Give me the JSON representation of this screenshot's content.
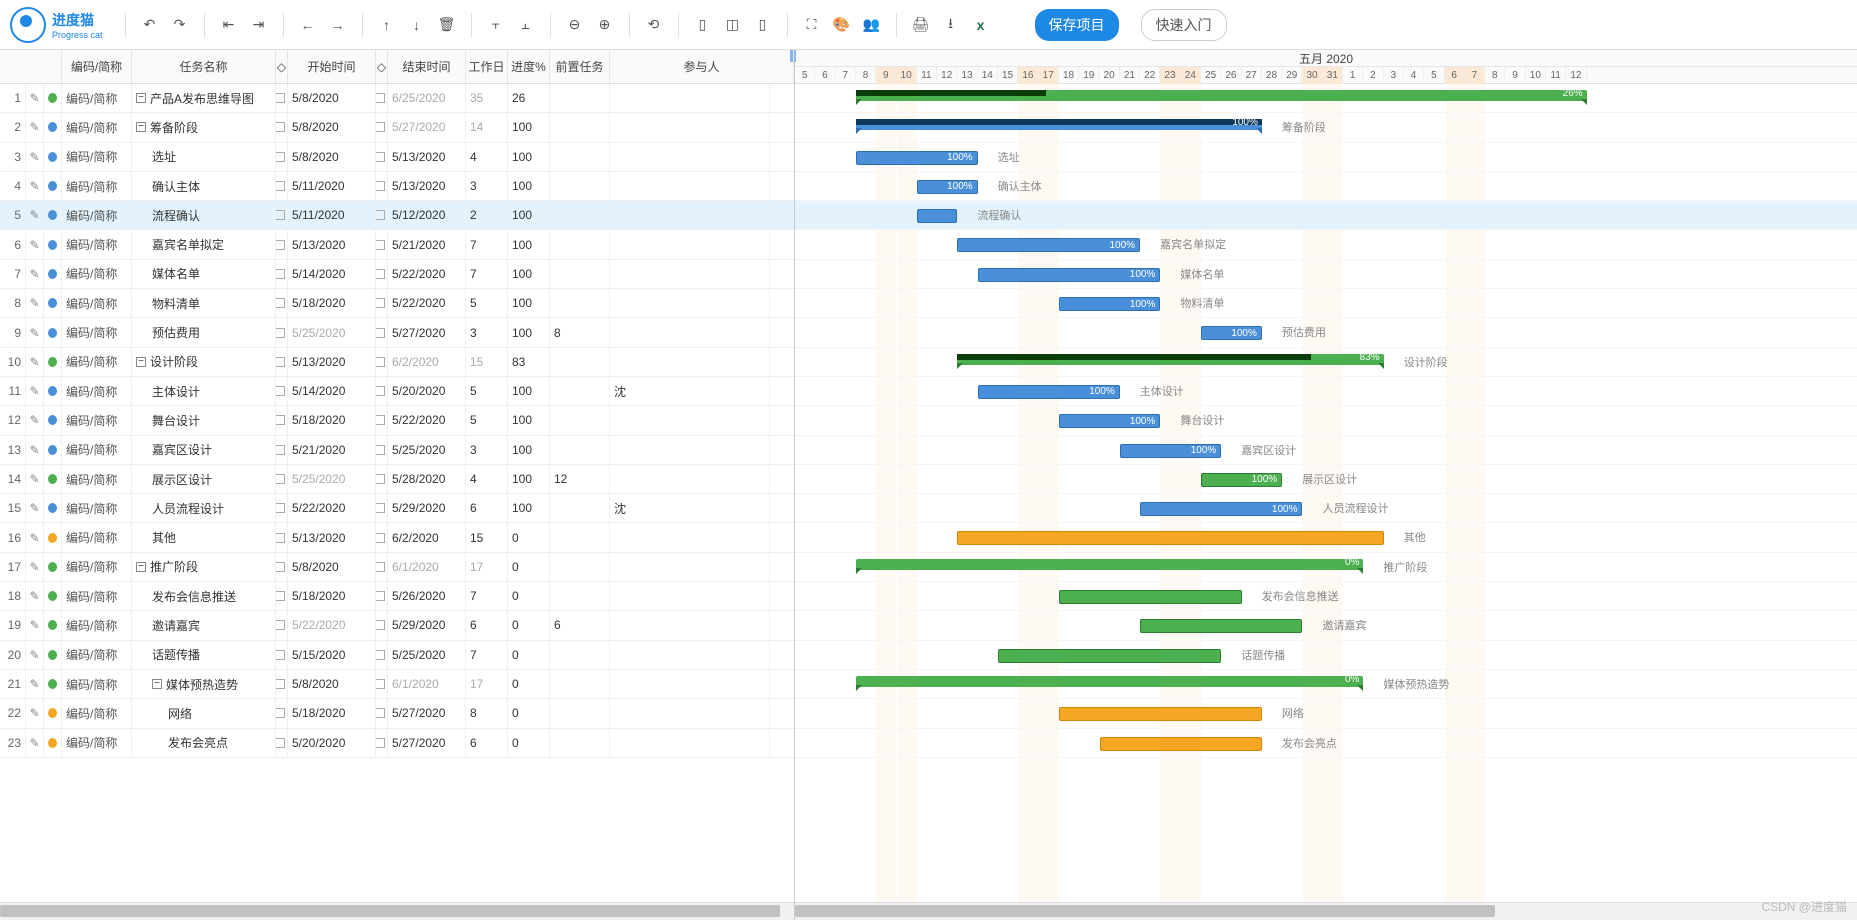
{
  "app": {
    "name_cn": "进度猫",
    "name_en": "Progress cat",
    "save": "保存项目",
    "quick": "快速入门"
  },
  "toolbar_icons": [
    "undo",
    "redo",
    "outdent",
    "indent",
    "move-left",
    "move-right",
    "move-up",
    "move-down",
    "delete",
    "top-align",
    "bottom-align",
    "zoom-out",
    "zoom-in",
    "fit",
    "col1",
    "col2",
    "col3",
    "fullscreen",
    "theme",
    "users",
    "print",
    "export",
    "excel"
  ],
  "columns": {
    "code": "编码/简称",
    "name": "任务名称",
    "start": "开始时间",
    "end": "结束时间",
    "days": "工作日",
    "progress": "进度%",
    "pred": "前置任务",
    "part": "参与人"
  },
  "timeline": {
    "month": "五月 2020",
    "days": [
      5,
      6,
      7,
      8,
      9,
      10,
      11,
      12,
      13,
      14,
      15,
      16,
      17,
      18,
      19,
      20,
      21,
      22,
      23,
      24,
      25,
      26,
      27,
      28,
      29,
      30,
      31,
      1,
      2,
      3,
      4,
      5,
      6,
      7,
      8,
      9,
      10,
      11,
      12
    ],
    "weekend_idx": [
      4,
      5,
      11,
      12,
      18,
      19,
      25,
      26,
      32,
      33
    ]
  },
  "code_label": "编码/简称",
  "tasks": [
    {
      "n": 1,
      "dot": "#4caf50",
      "name": "产品A发布思维导图",
      "exp": "-",
      "ind": 0,
      "start": "5/8/2020",
      "sf": false,
      "end": "6/25/2020",
      "ef": true,
      "days": "35",
      "df": true,
      "prog": "26",
      "type": "sum",
      "color": "g",
      "s": 3,
      "e": 38,
      "pct": 26
    },
    {
      "n": 2,
      "dot": "#4a90d9",
      "name": "筹备阶段",
      "exp": "-",
      "ind": 0,
      "start": "5/8/2020",
      "sf": false,
      "end": "5/27/2020",
      "ef": true,
      "days": "14",
      "df": true,
      "prog": "100",
      "type": "sum",
      "color": "b",
      "s": 3,
      "e": 22,
      "pct": 100,
      "lbl": "筹备阶段"
    },
    {
      "n": 3,
      "dot": "#4a90d9",
      "name": "选址",
      "ind": 1,
      "start": "5/8/2020",
      "sf": false,
      "end": "5/13/2020",
      "ef": false,
      "days": "4",
      "prog": "100",
      "type": "bar",
      "color": "blue",
      "s": 3,
      "e": 8,
      "lbl": "选址"
    },
    {
      "n": 4,
      "dot": "#4a90d9",
      "name": "确认主体",
      "ind": 1,
      "start": "5/11/2020",
      "sf": false,
      "end": "5/13/2020",
      "ef": false,
      "days": "3",
      "prog": "100",
      "type": "bar",
      "color": "blue",
      "s": 6,
      "e": 8,
      "lbl": "确认主体"
    },
    {
      "n": 5,
      "dot": "#4a90d9",
      "name": "流程确认",
      "ind": 1,
      "start": "5/11/2020",
      "sf": false,
      "end": "5/12/2020",
      "ef": false,
      "days": "2",
      "prog": "100",
      "type": "bar",
      "color": "blue",
      "s": 6,
      "e": 7,
      "lbl": "流程确认",
      "sel": true,
      "nopct": true
    },
    {
      "n": 6,
      "dot": "#4a90d9",
      "name": "嘉宾名单拟定",
      "ind": 1,
      "start": "5/13/2020",
      "sf": false,
      "end": "5/21/2020",
      "ef": false,
      "days": "7",
      "prog": "100",
      "type": "bar",
      "color": "blue",
      "s": 8,
      "e": 16,
      "lbl": "嘉宾名单拟定",
      "link_to": 9
    },
    {
      "n": 7,
      "dot": "#4a90d9",
      "name": "媒体名单",
      "ind": 1,
      "start": "5/14/2020",
      "sf": false,
      "end": "5/22/2020",
      "ef": false,
      "days": "7",
      "prog": "100",
      "type": "bar",
      "color": "blue",
      "s": 9,
      "e": 17,
      "lbl": "媒体名单"
    },
    {
      "n": 8,
      "dot": "#4a90d9",
      "name": "物料清单",
      "ind": 1,
      "start": "5/18/2020",
      "sf": false,
      "end": "5/22/2020",
      "ef": false,
      "days": "5",
      "prog": "100",
      "type": "bar",
      "color": "blue",
      "s": 13,
      "e": 17,
      "lbl": "物料清单"
    },
    {
      "n": 9,
      "dot": "#4a90d9",
      "name": "预估费用",
      "ind": 1,
      "start": "5/25/2020",
      "sf": true,
      "end": "5/27/2020",
      "ef": false,
      "days": "3",
      "prog": "100",
      "pred": "8",
      "type": "bar",
      "color": "blue",
      "s": 20,
      "e": 22,
      "lbl": "预估费用"
    },
    {
      "n": 10,
      "dot": "#4caf50",
      "name": "设计阶段",
      "exp": "-",
      "ind": 0,
      "start": "5/13/2020",
      "sf": false,
      "end": "6/2/2020",
      "ef": true,
      "days": "15",
      "df": true,
      "prog": "83",
      "type": "sum",
      "color": "g",
      "s": 8,
      "e": 28,
      "pct": 83,
      "lbl": "设计阶段"
    },
    {
      "n": 11,
      "dot": "#4a90d9",
      "name": "主体设计",
      "ind": 1,
      "start": "5/14/2020",
      "sf": false,
      "end": "5/20/2020",
      "ef": false,
      "days": "5",
      "prog": "100",
      "part": "沈",
      "type": "bar",
      "color": "blue",
      "s": 9,
      "e": 15,
      "lbl": "主体设计",
      "link_to": 14
    },
    {
      "n": 12,
      "dot": "#4a90d9",
      "name": "舞台设计",
      "ind": 1,
      "start": "5/18/2020",
      "sf": false,
      "end": "5/22/2020",
      "ef": false,
      "days": "5",
      "prog": "100",
      "type": "bar",
      "color": "blue",
      "s": 13,
      "e": 17,
      "lbl": "舞台设计"
    },
    {
      "n": 13,
      "dot": "#4a90d9",
      "name": "嘉宾区设计",
      "ind": 1,
      "start": "5/21/2020",
      "sf": false,
      "end": "5/25/2020",
      "ef": false,
      "days": "3",
      "prog": "100",
      "type": "bar",
      "color": "blue",
      "s": 16,
      "e": 20,
      "lbl": "嘉宾区设计"
    },
    {
      "n": 14,
      "dot": "#4caf50",
      "name": "展示区设计",
      "ind": 1,
      "start": "5/25/2020",
      "sf": true,
      "end": "5/28/2020",
      "ef": false,
      "days": "4",
      "prog": "100",
      "pred": "12",
      "type": "bar",
      "color": "green",
      "s": 20,
      "e": 23,
      "lbl": "展示区设计"
    },
    {
      "n": 15,
      "dot": "#4a90d9",
      "name": "人员流程设计",
      "ind": 1,
      "start": "5/22/2020",
      "sf": false,
      "end": "5/29/2020",
      "ef": false,
      "days": "6",
      "prog": "100",
      "part": "沈",
      "type": "bar",
      "color": "blue",
      "s": 17,
      "e": 24,
      "lbl": "人员流程设计"
    },
    {
      "n": 16,
      "dot": "#f5a623",
      "name": "其他",
      "ind": 1,
      "start": "5/13/2020",
      "sf": false,
      "end": "6/2/2020",
      "ef": false,
      "days": "15",
      "prog": "0",
      "type": "bar",
      "color": "orange",
      "s": 8,
      "e": 28,
      "lbl": "其他",
      "nopct": true
    },
    {
      "n": 17,
      "dot": "#4caf50",
      "name": "推广阶段",
      "exp": "-",
      "ind": 0,
      "start": "5/8/2020",
      "sf": false,
      "end": "6/1/2020",
      "ef": true,
      "days": "17",
      "df": true,
      "prog": "0",
      "type": "sum",
      "color": "g",
      "s": 3,
      "e": 27,
      "pct": 0,
      "lbl": "推广阶段"
    },
    {
      "n": 18,
      "dot": "#4caf50",
      "name": "发布会信息推送",
      "ind": 1,
      "start": "5/18/2020",
      "sf": false,
      "end": "5/26/2020",
      "ef": false,
      "days": "7",
      "prog": "0",
      "type": "bar",
      "color": "green",
      "s": 13,
      "e": 21,
      "lbl": "发布会信息推送",
      "nopct": true,
      "link_to": 19
    },
    {
      "n": 19,
      "dot": "#4caf50",
      "name": "邀请嘉宾",
      "ind": 1,
      "start": "5/22/2020",
      "sf": true,
      "end": "5/29/2020",
      "ef": false,
      "days": "6",
      "prog": "0",
      "pred": "6",
      "type": "bar",
      "color": "green",
      "s": 17,
      "e": 24,
      "lbl": "邀请嘉宾",
      "nopct": true
    },
    {
      "n": 20,
      "dot": "#4caf50",
      "name": "话题传播",
      "ind": 1,
      "start": "5/15/2020",
      "sf": false,
      "end": "5/25/2020",
      "ef": false,
      "days": "7",
      "prog": "0",
      "type": "bar",
      "color": "green",
      "s": 10,
      "e": 20,
      "lbl": "话题传播",
      "nopct": true
    },
    {
      "n": 21,
      "dot": "#4caf50",
      "name": "媒体预热造势",
      "exp": "-",
      "ind": 1,
      "start": "5/8/2020",
      "sf": false,
      "end": "6/1/2020",
      "ef": true,
      "days": "17",
      "df": true,
      "prog": "0",
      "type": "sum",
      "color": "g",
      "s": 3,
      "e": 27,
      "pct": 0,
      "lbl": "媒体预热造势"
    },
    {
      "n": 22,
      "dot": "#f5a623",
      "name": "网络",
      "ind": 2,
      "start": "5/18/2020",
      "sf": false,
      "end": "5/27/2020",
      "ef": false,
      "days": "8",
      "prog": "0",
      "type": "bar",
      "color": "orange",
      "s": 13,
      "e": 22,
      "lbl": "网络",
      "nopct": true
    },
    {
      "n": 23,
      "dot": "#f5a623",
      "name": "发布会亮点",
      "ind": 2,
      "start": "5/20/2020",
      "sf": false,
      "end": "5/27/2020",
      "ef": false,
      "days": "6",
      "prog": "0",
      "type": "bar",
      "color": "orange",
      "s": 15,
      "e": 22,
      "lbl": "发布会亮点",
      "nopct": true
    }
  ],
  "watermark": "CSDN @进度猫"
}
